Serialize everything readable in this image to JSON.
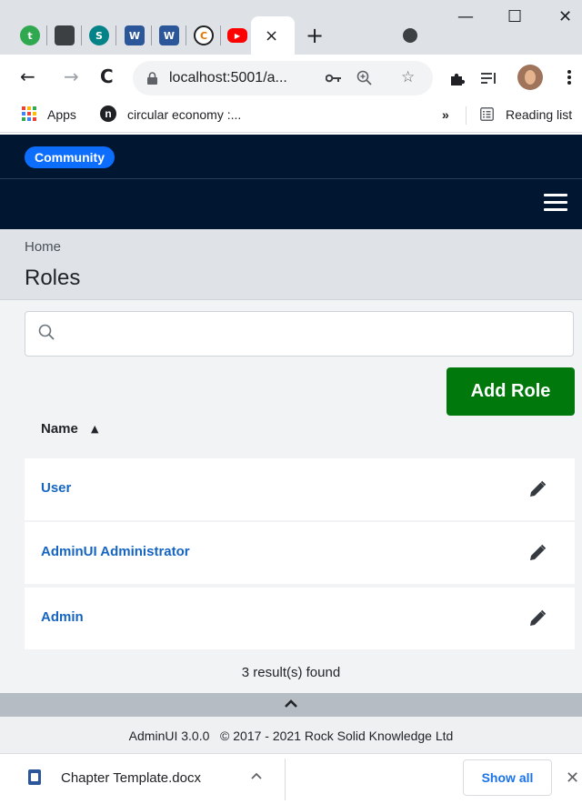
{
  "browser": {
    "tab_close": "×",
    "new_tab": "+",
    "window": {
      "minimize": "—",
      "maximize": "☐",
      "close": "✕"
    },
    "nav": {
      "back": "←",
      "forward": "→",
      "reload": "C"
    },
    "url": "localhost:5001/a...",
    "bookmarks": {
      "apps": "Apps",
      "circular": "circular economy :...",
      "overflow": "»",
      "reading_list": "Reading list"
    }
  },
  "app": {
    "brand": "Community",
    "breadcrumb": "Home",
    "title": "Roles",
    "search_placeholder": "",
    "add_button": "Add Role",
    "column_header": "Name",
    "sort_indicator": "▲",
    "rows": [
      {
        "name": "User"
      },
      {
        "name": "AdminUI Administrator"
      },
      {
        "name": "Admin"
      }
    ],
    "results": "3 result(s) found",
    "footer": "AdminUI 3.0.0   © 2017 - 2021 Rock Solid Knowledge Ltd"
  },
  "downloads": {
    "file": "Chapter Template.docx",
    "show_all": "Show all",
    "close": "✕"
  },
  "colors": {
    "header": "#001631",
    "pill": "#0d6efd",
    "add_button": "#00780c",
    "link": "#1565c0"
  }
}
